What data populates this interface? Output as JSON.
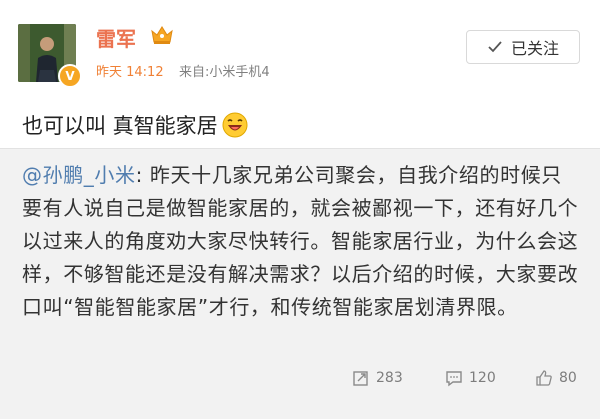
{
  "post": {
    "author": "雷军",
    "time": "昨天 14:12",
    "source": "来自:小米手机4",
    "follow_label": "已关注",
    "text": "也可以叫 真智能家居",
    "text_emoji": "laugh-emoji"
  },
  "repost": {
    "mention": "@孙鹏_小米",
    "text": ": 昨天十几家兄弟公司聚会，自我介绍的时候只要有人说自己是做智能家居的，就会被鄙视一下，还有好几个以过来人的角度劝大家尽快转行。智能家居行业，为什么会这样，不够智能还是没有解决需求？以后介绍的时候，大家要改口叫“智能智能家居”才行，和传统智能家居划清界限。",
    "repost_count": "283",
    "comment_count": "120",
    "like_count": "80"
  },
  "icons": {
    "verified": "verified-v-icon",
    "member": "member-crown-icon",
    "follow": "check-icon",
    "repost": "repost-icon",
    "comment": "comment-icon",
    "like": "thumbs-up-icon"
  },
  "colors": {
    "username": "#eb7350",
    "time": "#f08136",
    "mention": "#507daf",
    "verified": "#f6a623",
    "repost_bg": "#f2f2f2"
  }
}
